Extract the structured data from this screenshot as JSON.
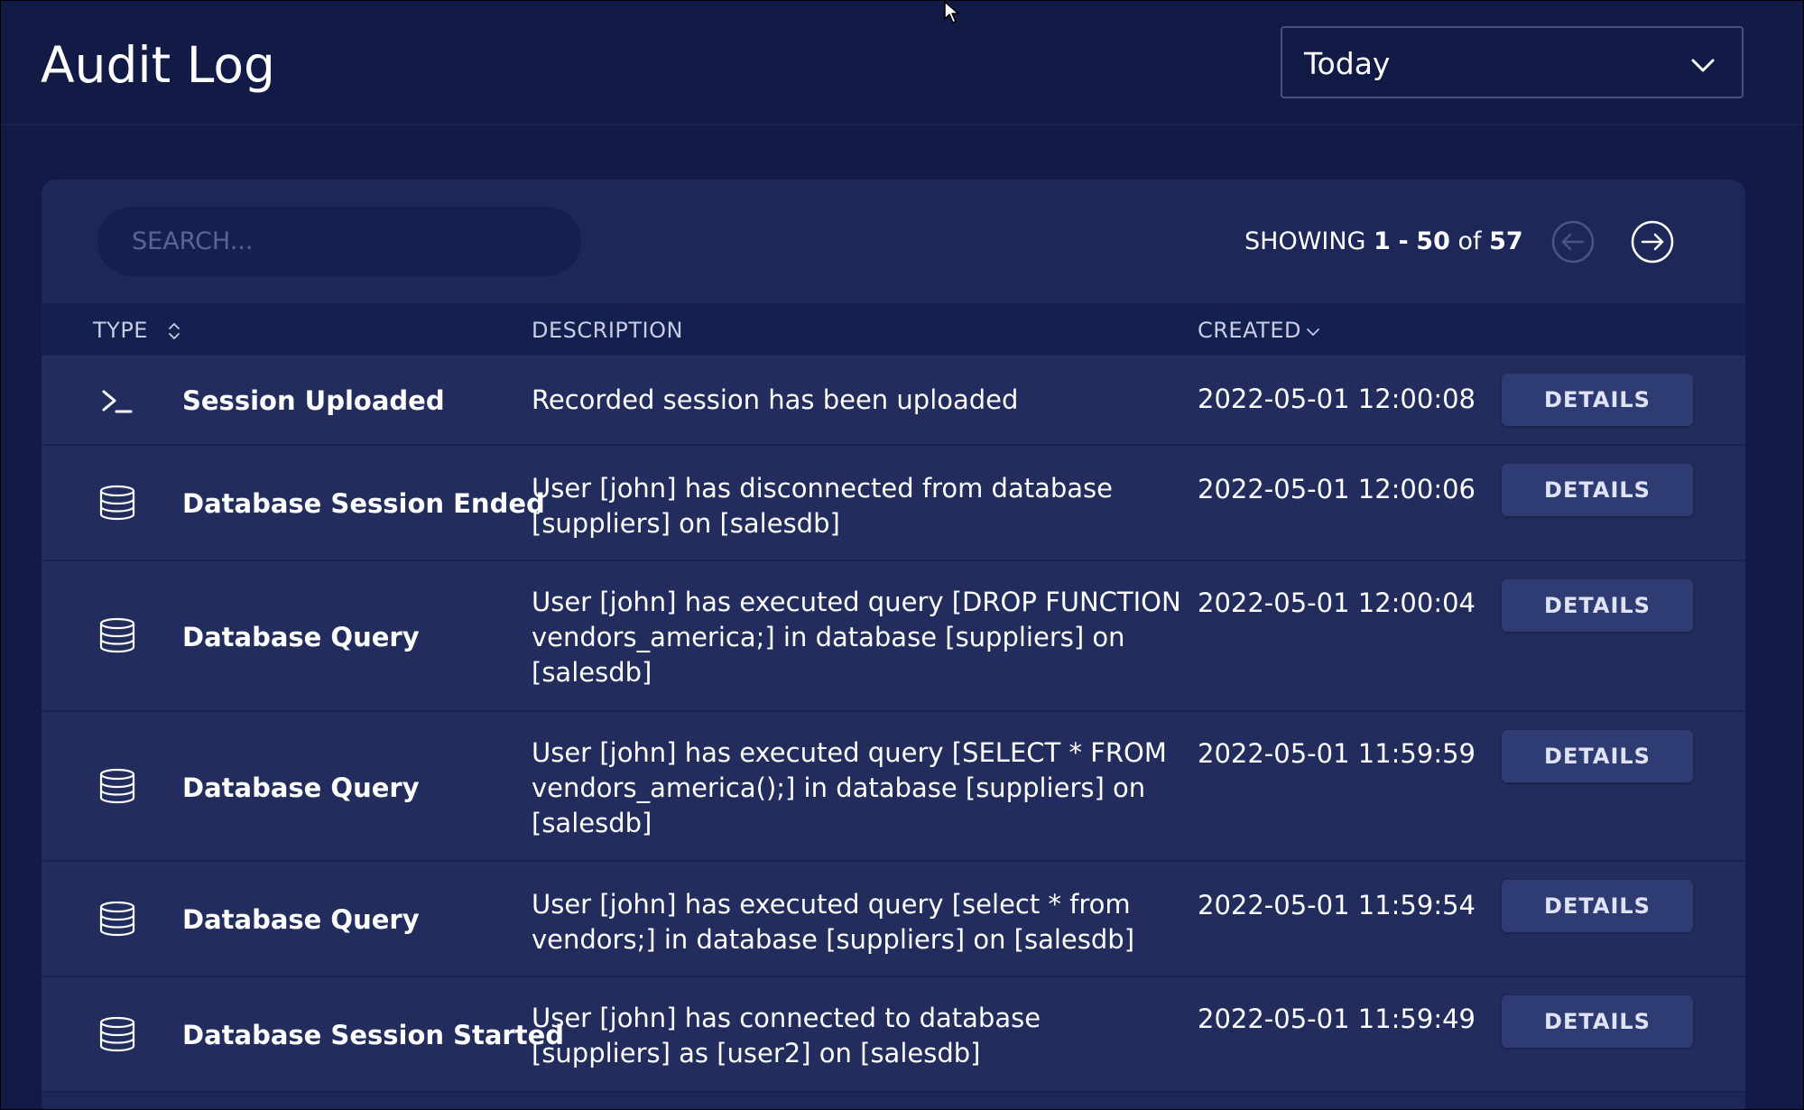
{
  "header": {
    "title": "Audit Log",
    "range_select": {
      "value": "Today",
      "icon": "chevron-down-icon"
    }
  },
  "toolbar": {
    "search_placeholder": "SEARCH...",
    "showing_prefix": "SHOWING",
    "range_start": "1",
    "range_sep": "-",
    "range_end": "50",
    "of_word": "of",
    "total": "57",
    "prev_icon": "arrow-left-circle-icon",
    "next_icon": "arrow-right-circle-icon"
  },
  "table": {
    "columns": {
      "type": "TYPE",
      "description": "DESCRIPTION",
      "created": "CREATED"
    },
    "details_label": "DETAILS",
    "rows": [
      {
        "icon": "terminal-icon",
        "type": "Session Uploaded",
        "description": "Recorded session has been uploaded",
        "created": "2022-05-01 12:00:08"
      },
      {
        "icon": "database-icon",
        "type": "Database Session Ended",
        "description": "User [john] has disconnected from database [suppliers] on [salesdb]",
        "created": "2022-05-01 12:00:06"
      },
      {
        "icon": "database-icon",
        "type": "Database Query",
        "description": "User [john] has executed query [DROP FUNCTION vendors_america;] in database [suppliers] on [salesdb]",
        "created": "2022-05-01 12:00:04"
      },
      {
        "icon": "database-icon",
        "type": "Database Query",
        "description": "User [john] has executed query [SELECT * FROM vendors_america();] in database [suppliers] on [salesdb]",
        "created": "2022-05-01 11:59:59"
      },
      {
        "icon": "database-icon",
        "type": "Database Query",
        "description": "User [john] has executed query [select * from vendors;] in database [suppliers] on [salesdb]",
        "created": "2022-05-01 11:59:54"
      },
      {
        "icon": "database-icon",
        "type": "Database Session Started",
        "description": "User [john] has connected to database [suppliers] as [user2] on [salesdb]",
        "created": "2022-05-01 11:59:49"
      }
    ]
  },
  "colors": {
    "page_bg": "#121b46",
    "card_bg": "#1d2859",
    "row_bg": "#222d5e",
    "button_bg": "#2f3c74"
  }
}
